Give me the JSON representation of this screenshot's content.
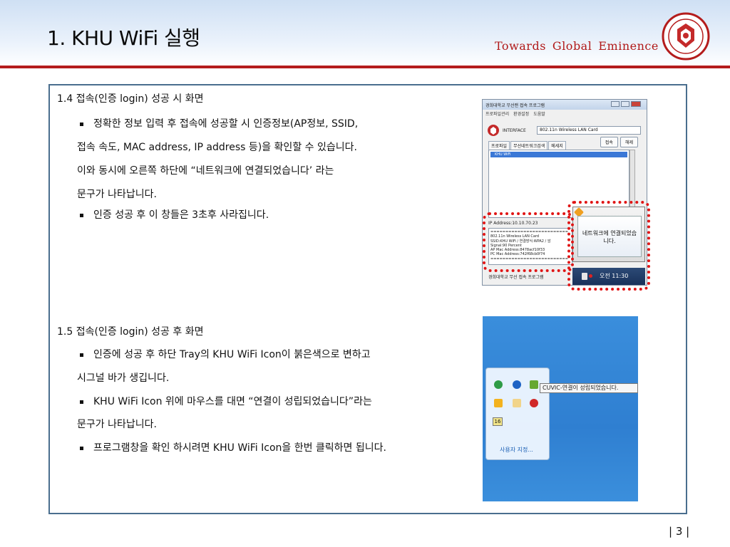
{
  "header": {
    "title": "1. KHU WiFi 실행",
    "tagline": [
      "Towards",
      "Global",
      "Eminence"
    ]
  },
  "section1": {
    "title": "1.4 접속(인증 login) 성공 시 화면",
    "bullet1": [
      "정확한 정보 입력 후 접속에 성공할 시 인증정보(AP정보, SSID,",
      "접속 속도, MAC address, IP address 등)을 확인할 수 있습니다.",
      "이와 동시에 오른쪽 하단에 “네트워크에 연결되었습니다’ 라는",
      "문구가 나타납니다."
    ],
    "bullet2": "인증 성공 후 이 창들은 3초후 사라집니다."
  },
  "section2": {
    "title": "1.5 접속(인증 login) 성공 후 화면",
    "bullet1": [
      "인증에 성공 후 하단 Tray의 KHU WiFi Icon이 붉은색으로 변하고",
      "시그널 바가 생깁니다."
    ],
    "bullet2": [
      "KHU WiFi Icon 위에 마우스를 대면 “연결이 성립되었습니다”라는",
      "문구가 나타납니다."
    ],
    "bullet3": "프로그램창을 확인 하시려면 KHU WiFi Icon을 한번 클릭하면 됩니다."
  },
  "window": {
    "title": "경희대학교 무선랜 접속 프로그램",
    "menu": [
      "프로파일관리",
      "환경설정",
      "도움말"
    ],
    "interface_label": "INTERFACE",
    "interface_value": "802.11n Wireless LAN Card",
    "tabs": [
      "프로파일",
      "무선네트워크검색",
      "메세지"
    ],
    "connect": "접속",
    "disconnect": "해제",
    "list_item": "KHU WiFi",
    "ip": "IP Address:10.10.70.23",
    "info": [
      "==========================",
      "802.11n Wireless LAN Card",
      "SSID:KHU WiFi / 연결방식:WPA2 / 암",
      "Signal:90 Percent",
      "AP Mac Address:8478acf10f33",
      "PC Mac Address:742f68cb0f74",
      "=========================="
    ],
    "footer": "경희대학교 무선 접속 프로그램"
  },
  "popup": {
    "message": [
      "네트워크에 연결되었습",
      "니다."
    ]
  },
  "taskbar": {
    "clock": "오전 11:30"
  },
  "tray": {
    "tooltip": "CUVIC-연결이 성립되었습니다.",
    "customize": "사용자 지정...",
    "num": "16"
  },
  "footer": {
    "page": "| 3 |"
  },
  "colors": {
    "accent": "#b41c1c",
    "frame": "#4a6e8e",
    "highlight": "#e01515"
  }
}
